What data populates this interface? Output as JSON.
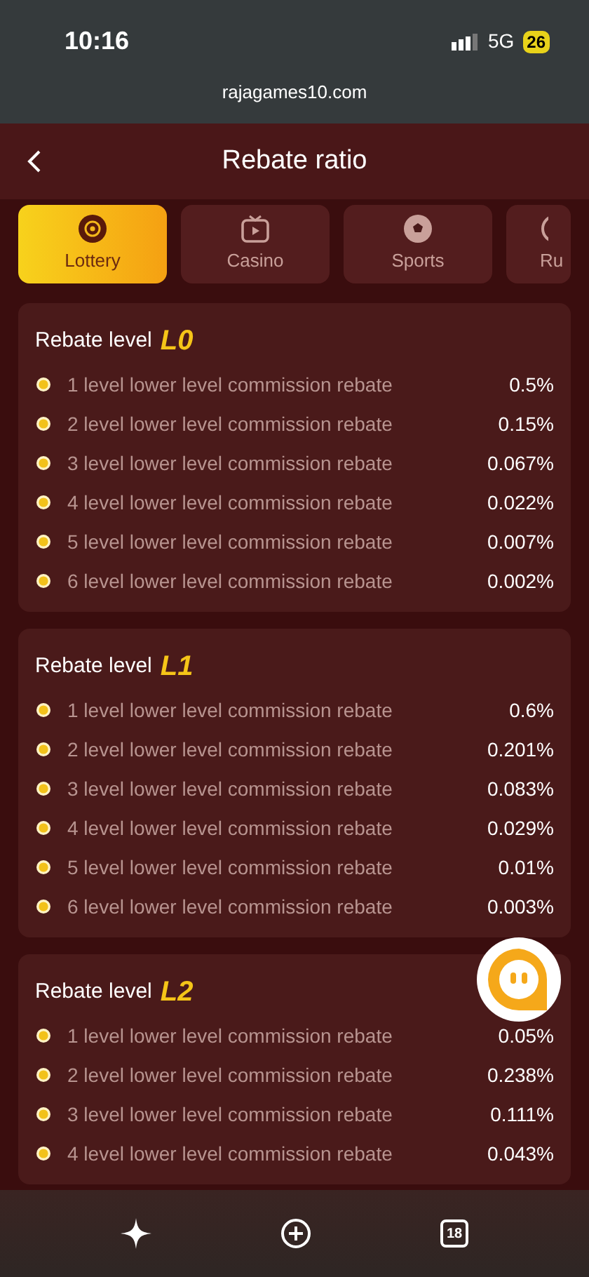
{
  "status_bar": {
    "time": "10:16",
    "network": "5G",
    "battery": "26"
  },
  "browser": {
    "url": "rajagames10.com"
  },
  "header": {
    "title": "Rebate ratio"
  },
  "tabs": [
    {
      "label": "Lottery",
      "selected": true,
      "kind": "lottery"
    },
    {
      "label": "Casino",
      "selected": false,
      "kind": "casino"
    },
    {
      "label": "Sports",
      "selected": false,
      "kind": "sports"
    },
    {
      "label": "Ru",
      "selected": false,
      "kind": "cut"
    }
  ],
  "levels": [
    {
      "title": "Rebate level",
      "badge": "L0",
      "rows": [
        {
          "label": "1 level lower level commission rebate",
          "value": "0.5%"
        },
        {
          "label": "2 level lower level commission rebate",
          "value": "0.15%"
        },
        {
          "label": "3 level lower level commission rebate",
          "value": "0.067%"
        },
        {
          "label": "4 level lower level commission rebate",
          "value": "0.022%"
        },
        {
          "label": "5 level lower level commission rebate",
          "value": "0.007%"
        },
        {
          "label": "6 level lower level commission rebate",
          "value": "0.002%"
        }
      ]
    },
    {
      "title": "Rebate level",
      "badge": "L1",
      "rows": [
        {
          "label": "1 level lower level commission rebate",
          "value": "0.6%"
        },
        {
          "label": "2 level lower level commission rebate",
          "value": "0.201%"
        },
        {
          "label": "3 level lower level commission rebate",
          "value": "0.083%"
        },
        {
          "label": "4 level lower level commission rebate",
          "value": "0.029%"
        },
        {
          "label": "5 level lower level commission rebate",
          "value": "0.01%"
        },
        {
          "label": "6 level lower level commission rebate",
          "value": "0.003%"
        }
      ]
    },
    {
      "title": "Rebate level",
      "badge": "L2",
      "rows": [
        {
          "label": "1 level lower level commission rebate",
          "value": "0.05%"
        },
        {
          "label": "2 level lower level commission rebate",
          "value": "0.238%"
        },
        {
          "label": "3 level lower level commission rebate",
          "value": "0.111%"
        },
        {
          "label": "4 level lower level commission rebate",
          "value": "0.043%"
        }
      ]
    }
  ],
  "bottom_bar": {
    "badge": "18"
  }
}
